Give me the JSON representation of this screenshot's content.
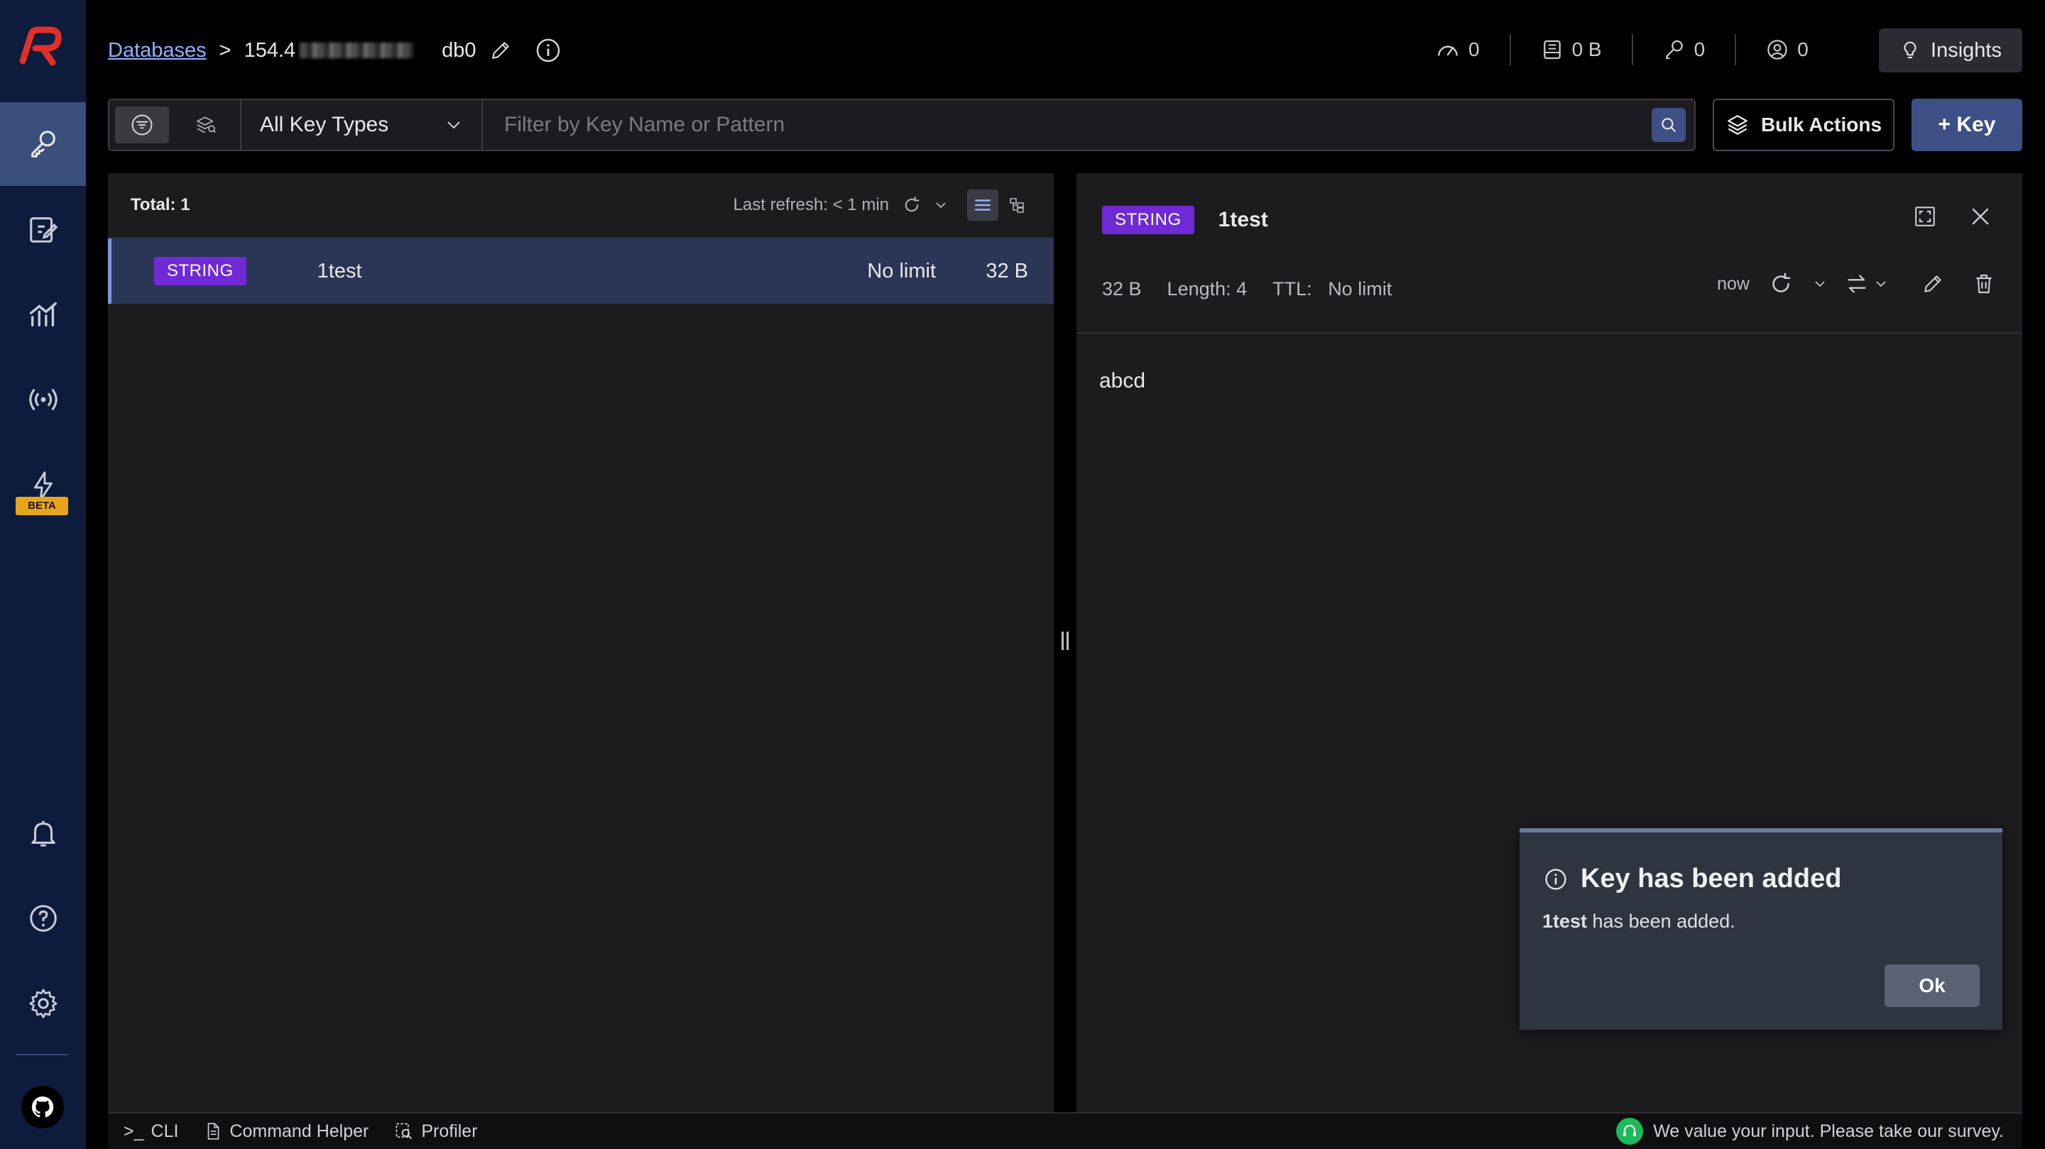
{
  "breadcrumb": {
    "databases_link": "Databases",
    "separator": ">",
    "host_prefix": "154.4",
    "db": "db0"
  },
  "stats": {
    "ops": "0",
    "memory": "0 B",
    "keys": "0",
    "clients": "0"
  },
  "insights_label": "Insights",
  "filter": {
    "key_type": "All Key Types",
    "search_placeholder": "Filter by Key Name or Pattern"
  },
  "bulk_actions_label": "Bulk Actions",
  "add_key_label": "+ Key",
  "list": {
    "total": "Total: 1",
    "last_refresh": "Last refresh: < 1 min",
    "rows": [
      {
        "type": "STRING",
        "name": "1test",
        "ttl": "No limit",
        "size": "32 B"
      }
    ]
  },
  "detail": {
    "type": "STRING",
    "name": "1test",
    "size": "32 B",
    "length": "Length: 4",
    "ttl_label": "TTL:",
    "ttl_value": "No limit",
    "refresh_time": "now",
    "value": "abcd"
  },
  "toast": {
    "title": "Key has been added",
    "key": "1test",
    "message": " has been added.",
    "ok": "Ok"
  },
  "sidebar": {
    "beta_label": "BETA"
  },
  "bottom": {
    "cli": "CLI",
    "cli_prefix": ">_",
    "command_helper": "Command Helper",
    "profiler": "Profiler",
    "survey": "We value your input. Please take our survey."
  },
  "colors": {
    "sidebar_bg": "#0d1b3c",
    "accent": "#3d4f85",
    "string_badge": "#6f2ad6",
    "logo": "#e0302a"
  }
}
